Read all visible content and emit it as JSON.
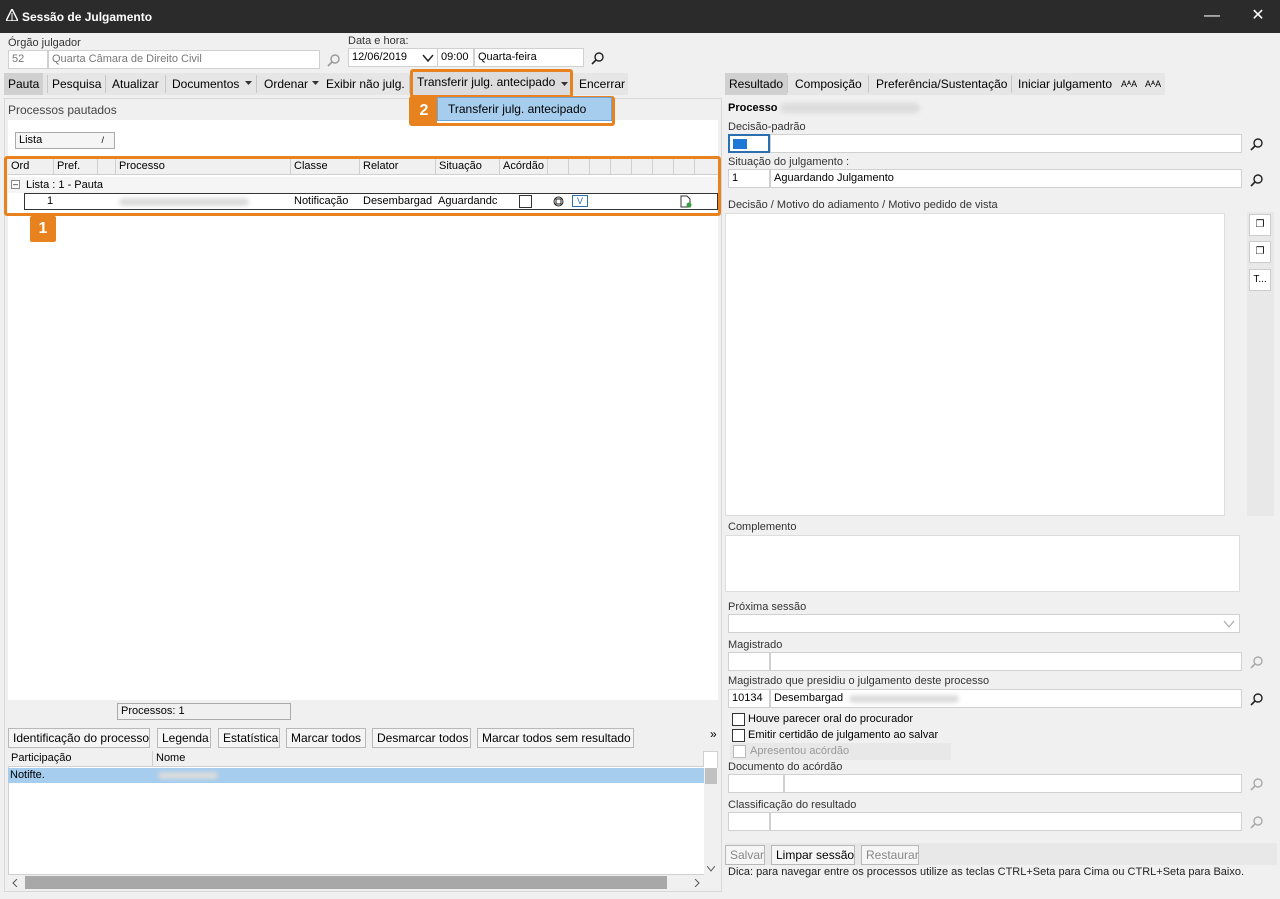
{
  "window": {
    "title": "Sessão de Julgamento"
  },
  "header": {
    "orgao_label": "Órgão julgador",
    "orgao_code": "52",
    "orgao_name": "Quarta Câmara de Direito Civil",
    "datetime_label": "Data e hora:",
    "date": "12/06/2019",
    "time": "09:00",
    "weekday": "Quarta-feira"
  },
  "toolbar_left": {
    "pauta": "Pauta",
    "pesquisa": "Pesquisa",
    "atualizar": "Atualizar",
    "documentos": "Documentos",
    "ordenar": "Ordenar",
    "exibir": "Exibir não julg.",
    "transferir": "Transferir julg. antecipado",
    "encerrar": "Encerrar"
  },
  "dropdown": {
    "item": "Transferir julg. antecipado"
  },
  "callouts": {
    "one": "1",
    "two": "2"
  },
  "left": {
    "section_title": "Processos pautados",
    "group_box": "Lista",
    "group_box_sort": "/",
    "columns": [
      "Ord",
      "Pref.",
      "Processo",
      "Classe",
      "Relator",
      "Situação",
      "Acórdão"
    ],
    "group_row": "Lista : 1 - Pauta",
    "row": {
      "ord": "1",
      "classe": "Notificação",
      "relator": "Desembargad",
      "situacao": "Aguardandc",
      "v_icon": "V"
    },
    "processos_count": "Processos: 1",
    "bottom_tabs": [
      "Identificação do processo",
      "Legenda",
      "Estatística",
      "Marcar todos",
      "Desmarcar todos",
      "Marcar todos sem resultado"
    ],
    "more": "»",
    "part_cols": [
      "Participação",
      "Nome"
    ],
    "part_row": "Notifte."
  },
  "right": {
    "tabs": [
      "Resultado",
      "Composição",
      "Preferência/Sustentação",
      "Iniciar julgamento"
    ],
    "font_icons": [
      "AᴬA",
      "AᴬA"
    ],
    "processo_label": "Processo",
    "decisao_padrao_label": "Decisão-padrão",
    "situacao_label": "Situação do julgamento :",
    "situacao_code": "1",
    "situacao_value": "Aguardando Julgamento",
    "motivo_label": "Decisão / Motivo do adiamento / Motivo pedido de vista",
    "complemento_label": "Complemento",
    "proxima_label": "Próxima sessão",
    "magistrado_label": "Magistrado",
    "presidiu_label": "Magistrado que presidiu o julgamento deste processo",
    "presidiu_code": "10134",
    "presidiu_name": "Desembargad",
    "check1": "Houve parecer oral do procurador",
    "check2": "Emitir certidão de julgamento ao salvar",
    "check3": "Apresentou acórdão",
    "documento_label": "Documento do acórdão",
    "classificacao_label": "Classificação do resultado",
    "buttons": [
      "Salvar",
      "Limpar sessão",
      "Restaurar"
    ],
    "hint": "Dica: para navegar entre os processos utilize as teclas CTRL+Seta para Cima ou CTRL+Seta para Baixo.",
    "side_t": "T..."
  },
  "colors": {
    "accent": "#e8821e",
    "selection": "#a6cdee",
    "titlebar": "#2b2b2b"
  }
}
